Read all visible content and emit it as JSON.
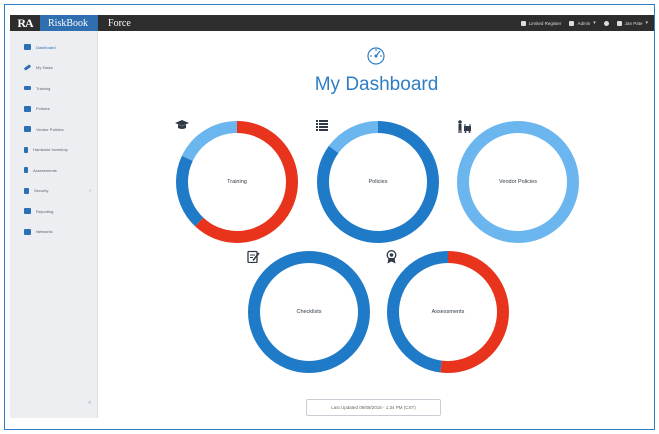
{
  "topbar": {
    "logo_text": "RA",
    "product": "RiskBook",
    "module": "Force",
    "right_items": [
      {
        "label": "Limited Register",
        "icon": "user-icon"
      },
      {
        "label": "Admin",
        "icon": "gear-icon",
        "caret": "▾"
      },
      {
        "label": "",
        "icon": "help-icon"
      },
      {
        "label": "Jan Pate",
        "icon": "user-icon",
        "caret": "▾"
      }
    ],
    "colors": {
      "bar": "#2d2d2d",
      "product_bg": "#2f6fb0"
    }
  },
  "sidebar": {
    "items": [
      {
        "label": "Dashboard",
        "icon": "dashboard-icon"
      },
      {
        "label": "My Tasks",
        "icon": "pencil-icon"
      },
      {
        "label": "Training",
        "icon": "graduation-cap-icon"
      },
      {
        "label": "Policies",
        "icon": "list-icon"
      },
      {
        "label": "Vendor Policies",
        "icon": "vendor-icon"
      },
      {
        "label": "Hardware Inventory",
        "icon": "hardware-icon"
      },
      {
        "label": "Assessments",
        "icon": "award-icon"
      },
      {
        "label": "Security",
        "icon": "lock-icon",
        "caret": "›"
      },
      {
        "label": "Reporting",
        "icon": "chart-icon"
      },
      {
        "label": "Networks",
        "icon": "network-icon"
      }
    ],
    "collapse_glyph": "«"
  },
  "main": {
    "title": "My Dashboard",
    "title_icon": "dashboard-gauge-icon",
    "accent": "#2f7ec4",
    "footer": "Last Updated 08/08/2018 - 1:34 PM (CST)"
  },
  "donuts": [
    {
      "label": "Training",
      "icon": "graduation-cap-icon",
      "segments": [
        {
          "color": "#e8341c",
          "fraction": 0.62
        },
        {
          "color": "#1f7ac7",
          "fraction": 0.2
        },
        {
          "color": "#6cb6ef",
          "fraction": 0.18
        }
      ]
    },
    {
      "label": "Policies",
      "icon": "list-icon",
      "segments": [
        {
          "color": "#1f7ac7",
          "fraction": 0.85
        },
        {
          "color": "#6cb6ef",
          "fraction": 0.15
        }
      ]
    },
    {
      "label": "Vendor Policies",
      "icon": "vendor-icon",
      "segments": [
        {
          "color": "#6cb6ef",
          "fraction": 1.0
        }
      ]
    },
    {
      "label": "Checklists",
      "icon": "checklist-icon",
      "segments": [
        {
          "color": "#1f7ac7",
          "fraction": 1.0
        }
      ]
    },
    {
      "label": "Assessments",
      "icon": "award-icon",
      "segments": [
        {
          "color": "#e8341c",
          "fraction": 0.52
        },
        {
          "color": "#1f7ac7",
          "fraction": 0.48
        }
      ]
    }
  ]
}
